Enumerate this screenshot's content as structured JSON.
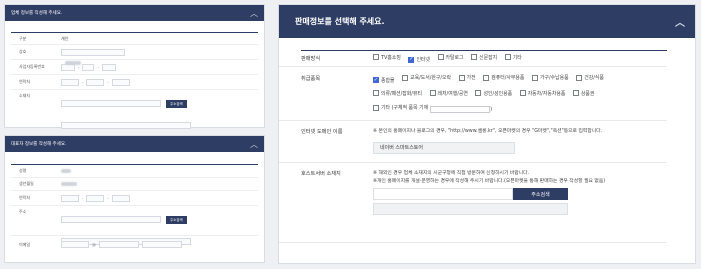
{
  "company_panel": {
    "title": "업체 정보를 작성해 주세요.",
    "rows": [
      {
        "label": "구분",
        "value": "개인"
      },
      {
        "label": "상호",
        "value": ""
      },
      {
        "label": "사업자등록번호",
        "value": ""
      },
      {
        "label": "연락처",
        "value": ""
      },
      {
        "label": "소재지",
        "value": ""
      }
    ],
    "search_button": "주소검색"
  },
  "rep_panel": {
    "title": "대표자 정보를 작성해 주세요.",
    "rows": [
      {
        "label": "성명",
        "value": ""
      },
      {
        "label": "생년월일",
        "value": ""
      },
      {
        "label": "연락처",
        "value": ""
      },
      {
        "label": "주소",
        "value": ""
      },
      {
        "label": "이메일",
        "value": ""
      }
    ],
    "search_button": "주소검색"
  },
  "sales_panel": {
    "title": "판매정보를 선택해 주세요.",
    "sales_method": {
      "label": "판매방식",
      "options": [
        {
          "text": "TV홈쇼핑",
          "checked": false
        },
        {
          "text": "인터넷",
          "checked": true
        },
        {
          "text": "카탈로그",
          "checked": false
        },
        {
          "text": "신문잡지",
          "checked": false
        },
        {
          "text": "기타",
          "checked": false
        }
      ]
    },
    "items": {
      "label": "취급품목",
      "row1": [
        {
          "text": "종합몰",
          "checked": true
        },
        {
          "text": "교육/도서/완구/오락",
          "checked": false
        },
        {
          "text": "가전",
          "checked": false
        },
        {
          "text": "컴퓨터/사무용품",
          "checked": false
        },
        {
          "text": "가구/수납용품",
          "checked": false
        },
        {
          "text": "건강/식품",
          "checked": false
        }
      ],
      "row2": [
        {
          "text": "의류/패션/잡화/뷰티",
          "checked": false
        },
        {
          "text": "레저/여행/공연",
          "checked": false
        },
        {
          "text": "성인/성인용품",
          "checked": false
        },
        {
          "text": "자동차/자동차용품",
          "checked": false
        },
        {
          "text": "상품권",
          "checked": false
        }
      ],
      "etc_label": "기타 (구체적 품목 기재",
      "etc_close": ")"
    },
    "domain": {
      "label": "인터넷 도메인 이름",
      "note": "※ 본인의 홈페이지나 블로그의 경우, \"http://www.셀롱.kr\", 오픈마켓의 경우 \"G마켓\",\"옥션\"등으로 입력합니다.",
      "value": "네이버 스마트스토어"
    },
    "host": {
      "label": "호스트서버 소재지",
      "note1": "※ 해외인 경우 업체 소재지의 시군구청에 직접 방문하여 신청하시기 바랍니다.",
      "note2": "※개인 홈페이지를 개설·운영하는 경우에 작성해 주시기 바랍니다.(오픈마켓을 통해 판매하는 경우 작성할 필요 없음)",
      "button": "주소검색"
    }
  }
}
